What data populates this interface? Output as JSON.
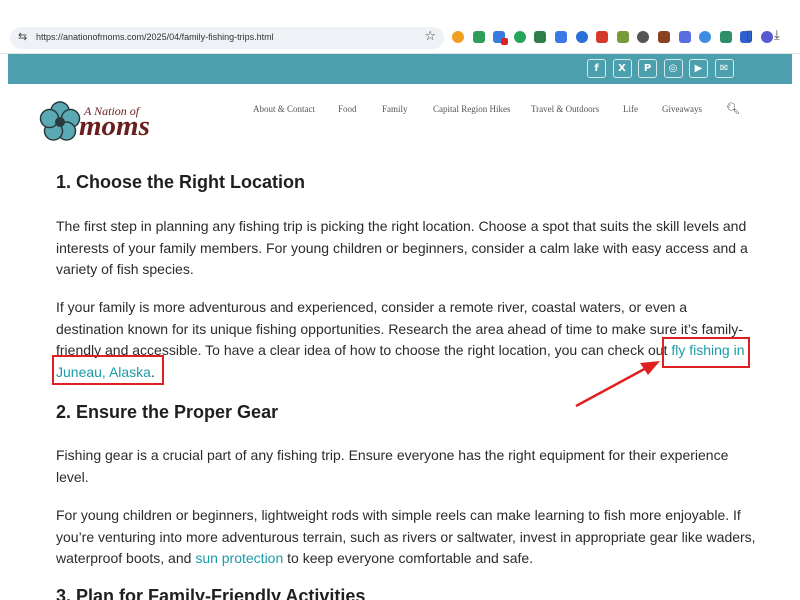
{
  "browser": {
    "url": "https://anationofmoms.com/2025/04/family-fishing-trips.html",
    "tune_icon": "tune-icon",
    "bookmark_icon": "star-icon",
    "extensions": [
      {
        "icon": "sun-extension-icon",
        "color": "#f0a020"
      },
      {
        "icon": "grammarly-extension-icon",
        "color": "#2f9e56"
      },
      {
        "icon": "chrome-extension-icon",
        "color": "#3a7be0"
      },
      {
        "icon": "green-g-extension-icon",
        "color": "#25a55a"
      },
      {
        "icon": "g-extension-icon",
        "color": "#2f7d4a"
      },
      {
        "icon": "mail-extension-icon",
        "color": "#3b78e7"
      },
      {
        "icon": "calendar-extension-icon",
        "color": "#2a6fd6"
      },
      {
        "icon": "s-extension-icon",
        "color": "#d33a2c"
      },
      {
        "icon": "inbox-extension-icon",
        "color": "#7a9a3a"
      },
      {
        "icon": "reader-extension-icon",
        "color": "#555555"
      },
      {
        "icon": "photo-extension-icon",
        "color": "#884422"
      },
      {
        "icon": "email-extension-icon",
        "color": "#5a6de0"
      },
      {
        "icon": "globe-extension-icon",
        "color": "#3d8de0"
      },
      {
        "icon": "puzzle-extension-icon",
        "color": "#2d8f6a"
      },
      {
        "icon": "shield-extension-icon",
        "color": "#3060d0"
      },
      {
        "icon": "envelope-extension-icon",
        "color": "#5a5ad0"
      }
    ]
  },
  "site": {
    "logo_small": "A Nation of",
    "logo_big": "moms",
    "social_icons": [
      {
        "name": "facebook-icon",
        "glyph": "f"
      },
      {
        "name": "x-icon",
        "glyph": "X"
      },
      {
        "name": "pinterest-icon",
        "glyph": "P"
      },
      {
        "name": "instagram-icon",
        "glyph": "◎"
      },
      {
        "name": "youtube-icon",
        "glyph": "▶"
      },
      {
        "name": "email-icon",
        "glyph": "✉"
      }
    ],
    "nav": [
      "About & Contact",
      "Food",
      "Family",
      "Capital Region Hikes",
      "Travel & Outdoors",
      "Life",
      "Giveaways"
    ]
  },
  "article": {
    "h1": "1. Choose the Right Location",
    "p1": "The first step in planning any fishing trip is picking the right location. Choose a spot that suits the skill levels and interests of your family members. For young children or beginners, consider a calm lake with easy access and a variety of fish species.",
    "p2_text": "If your family is more adventurous and experienced, consider a remote river, coastal waters, or even a destination known for its unique fishing opportunities. Research the area ahead of time to make sure it’s family-friendly and accessible. To have a clear idea of how to choose the right location, you can check out ",
    "p2_link": "fly fishing in Juneau, Alaska",
    "p2_end": ".",
    "h2": "2. Ensure the Proper Gear",
    "p3": "Fishing gear is a crucial part of any fishing trip. Ensure everyone has the right equipment for their experience level.",
    "p4_text": "For young children or beginners, lightweight rods with simple reels can make learning to fish more enjoyable. If you’re venturing into more adventurous terrain, such as rivers or saltwater, invest in appropriate gear like waders, waterproof boots, and ",
    "p4_link": "sun protection",
    "p4_end": " to keep everyone comfortable and safe.",
    "h3": "3. Plan for Family-Friendly Activities"
  },
  "colors": {
    "teal": "#4c9fad",
    "link": "#1a9ba8",
    "logo": "#6b1e1e",
    "annotation": "#e02020"
  }
}
